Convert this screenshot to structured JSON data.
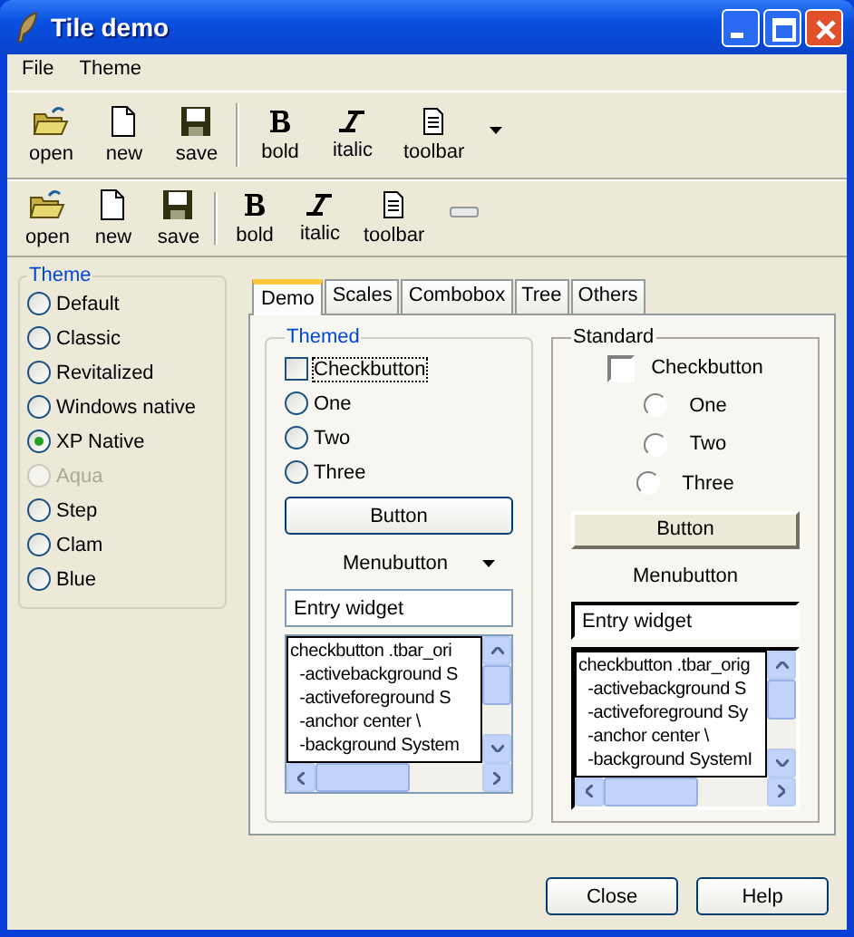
{
  "window": {
    "title": "Tile demo"
  },
  "menu": [
    "File",
    "Theme"
  ],
  "toolbars": [
    {
      "items": [
        {
          "label": "open",
          "kind": "open"
        },
        {
          "label": "new",
          "kind": "new"
        },
        {
          "label": "save",
          "kind": "save"
        },
        {
          "label": "bold",
          "kind": "bold"
        },
        {
          "label": "italic",
          "kind": "italic"
        },
        {
          "label": "toolbar",
          "kind": "toolbar"
        }
      ],
      "kind": "menu"
    },
    {
      "items": [
        {
          "label": "open",
          "kind": "open"
        },
        {
          "label": "new",
          "kind": "new"
        },
        {
          "label": "save",
          "kind": "save"
        },
        {
          "label": "bold",
          "kind": "bold"
        },
        {
          "label": "italic",
          "kind": "italic"
        },
        {
          "label": "toolbar",
          "kind": "toolbar"
        }
      ],
      "kind": "slider"
    }
  ],
  "theme": {
    "title": "Theme",
    "options": [
      {
        "label": "Default",
        "selected": false,
        "disabled": false
      },
      {
        "label": "Classic",
        "selected": false,
        "disabled": false
      },
      {
        "label": "Revitalized",
        "selected": false,
        "disabled": false
      },
      {
        "label": "Windows native",
        "selected": false,
        "disabled": false
      },
      {
        "label": "XP Native",
        "selected": true,
        "disabled": false
      },
      {
        "label": "Aqua",
        "selected": false,
        "disabled": true
      },
      {
        "label": "Step",
        "selected": false,
        "disabled": false
      },
      {
        "label": "Clam",
        "selected": false,
        "disabled": false
      },
      {
        "label": "Blue",
        "selected": false,
        "disabled": false
      }
    ]
  },
  "tabs": [
    {
      "label": "Demo",
      "selected": true
    },
    {
      "label": "Scales",
      "selected": false
    },
    {
      "label": "Combobox",
      "selected": false
    },
    {
      "label": "Tree",
      "selected": false
    },
    {
      "label": "Others",
      "selected": false
    }
  ],
  "panels": [
    {
      "kind": "themed",
      "title": "Themed",
      "checkbutton": {
        "label": "Checkbutton",
        "checked": false
      },
      "radios": [
        {
          "label": "One",
          "selected": false
        },
        {
          "label": "Two",
          "selected": false
        },
        {
          "label": "Three",
          "selected": false
        }
      ],
      "button": "Button",
      "menubutton": "Menubutton",
      "entry": "Entry widget",
      "text_lines": [
        "checkbutton .tbar_ori",
        "  -activebackground S",
        "  -activeforeground S",
        "  -anchor center \\",
        "  -background System"
      ]
    },
    {
      "kind": "standard",
      "title": "Standard",
      "checkbutton": {
        "label": "Checkbutton",
        "checked": false
      },
      "radios": [
        {
          "label": "One",
          "selected": false
        },
        {
          "label": "Two",
          "selected": false
        },
        {
          "label": "Three",
          "selected": false
        }
      ],
      "button": "Button",
      "menubutton": "Menubutton",
      "entry": "Entry widget",
      "text_lines": [
        "checkbutton .tbar_orig",
        "  -activebackground S",
        "  -activeforeground Sy",
        "  -anchor center \\",
        "  -background SystemI"
      ]
    }
  ],
  "buttons": [
    "Close",
    "Help"
  ]
}
